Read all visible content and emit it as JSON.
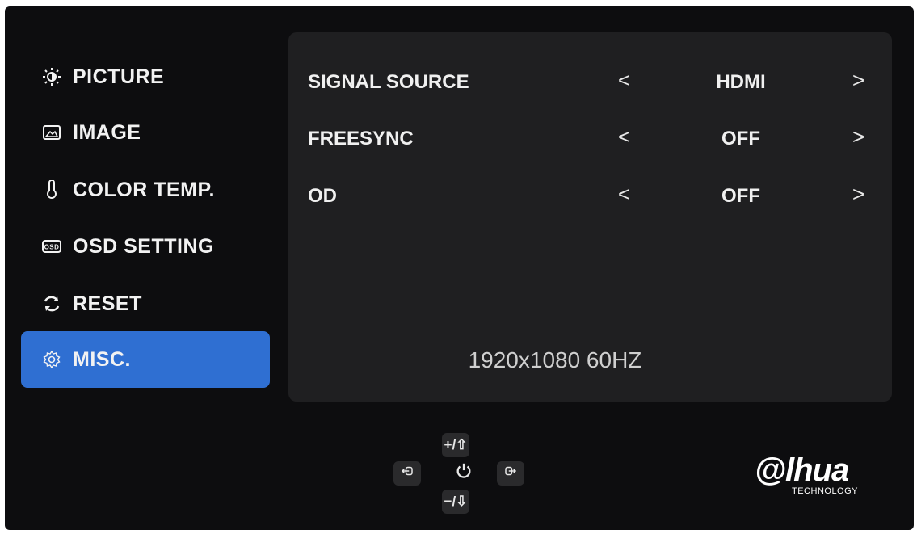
{
  "sidebar": {
    "items": [
      {
        "label": "PICTURE",
        "icon": "brightness-icon"
      },
      {
        "label": "IMAGE",
        "icon": "image-icon"
      },
      {
        "label": "COLOR TEMP.",
        "icon": "thermometer-icon"
      },
      {
        "label": "OSD SETTING",
        "icon": "osd-icon"
      },
      {
        "label": "RESET",
        "icon": "reset-icon"
      },
      {
        "label": "MISC.",
        "icon": "gear-icon",
        "active": true
      }
    ]
  },
  "settings": [
    {
      "label": "SIGNAL SOURCE",
      "value": "HDMI",
      "left_arrow": "<",
      "right_arrow": ">"
    },
    {
      "label": "FREESYNC",
      "value": "OFF",
      "left_arrow": "<",
      "right_arrow": ">"
    },
    {
      "label": "OD",
      "value": "OFF",
      "left_arrow": "<",
      "right_arrow": ">"
    }
  ],
  "status": {
    "resolution": "1920x1080 60HZ"
  },
  "keys": {
    "up": "+/⇧",
    "down": "−/⇩"
  },
  "brand": {
    "logo_text": "@lhua",
    "logo_sub": "TECHNOLOGY"
  },
  "colors": {
    "active_bg": "#2f6fd2",
    "panel_bg": "#1f1f21",
    "screen_bg": "#0d0d0f"
  }
}
